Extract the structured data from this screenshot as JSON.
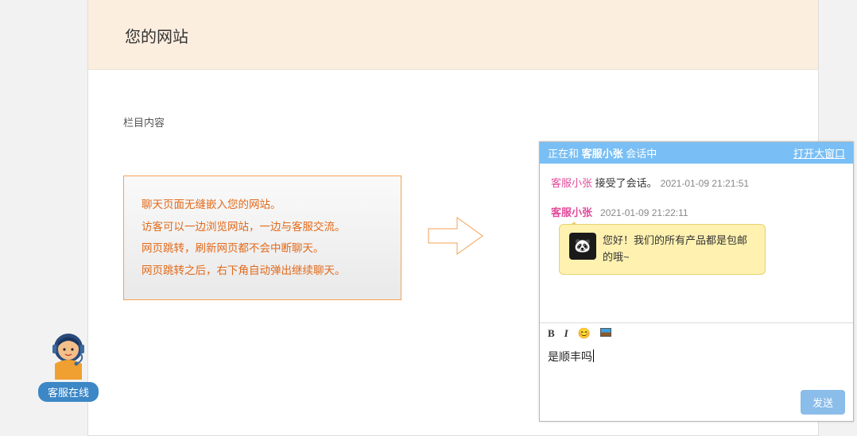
{
  "site": {
    "title": "您的网站"
  },
  "content": {
    "column_label": "栏目内容",
    "explain_lines": [
      "聊天页面无缝嵌入您的网站。",
      "访客可以一边浏览网站，一边与客服交流。",
      "网页跳转，刷新网页都不会中断聊天。",
      "网页跳转之后，右下角自动弹出继续聊天。"
    ]
  },
  "chat": {
    "header_prefix": "正在和 ",
    "agent_name": "客服小张",
    "header_suffix": " 会话中",
    "open_big": "打开大窗口",
    "sys_accept": " 接受了会话。",
    "sys_ts": "2021-01-09 21:21:51",
    "msg_ts": "2021-01-09 21:22:11",
    "bubble_text": "您好！我们的所有产品都是包邮的哦~",
    "input_value": "是顺丰吗",
    "send": "发送"
  },
  "support": {
    "label": "客服在线"
  }
}
